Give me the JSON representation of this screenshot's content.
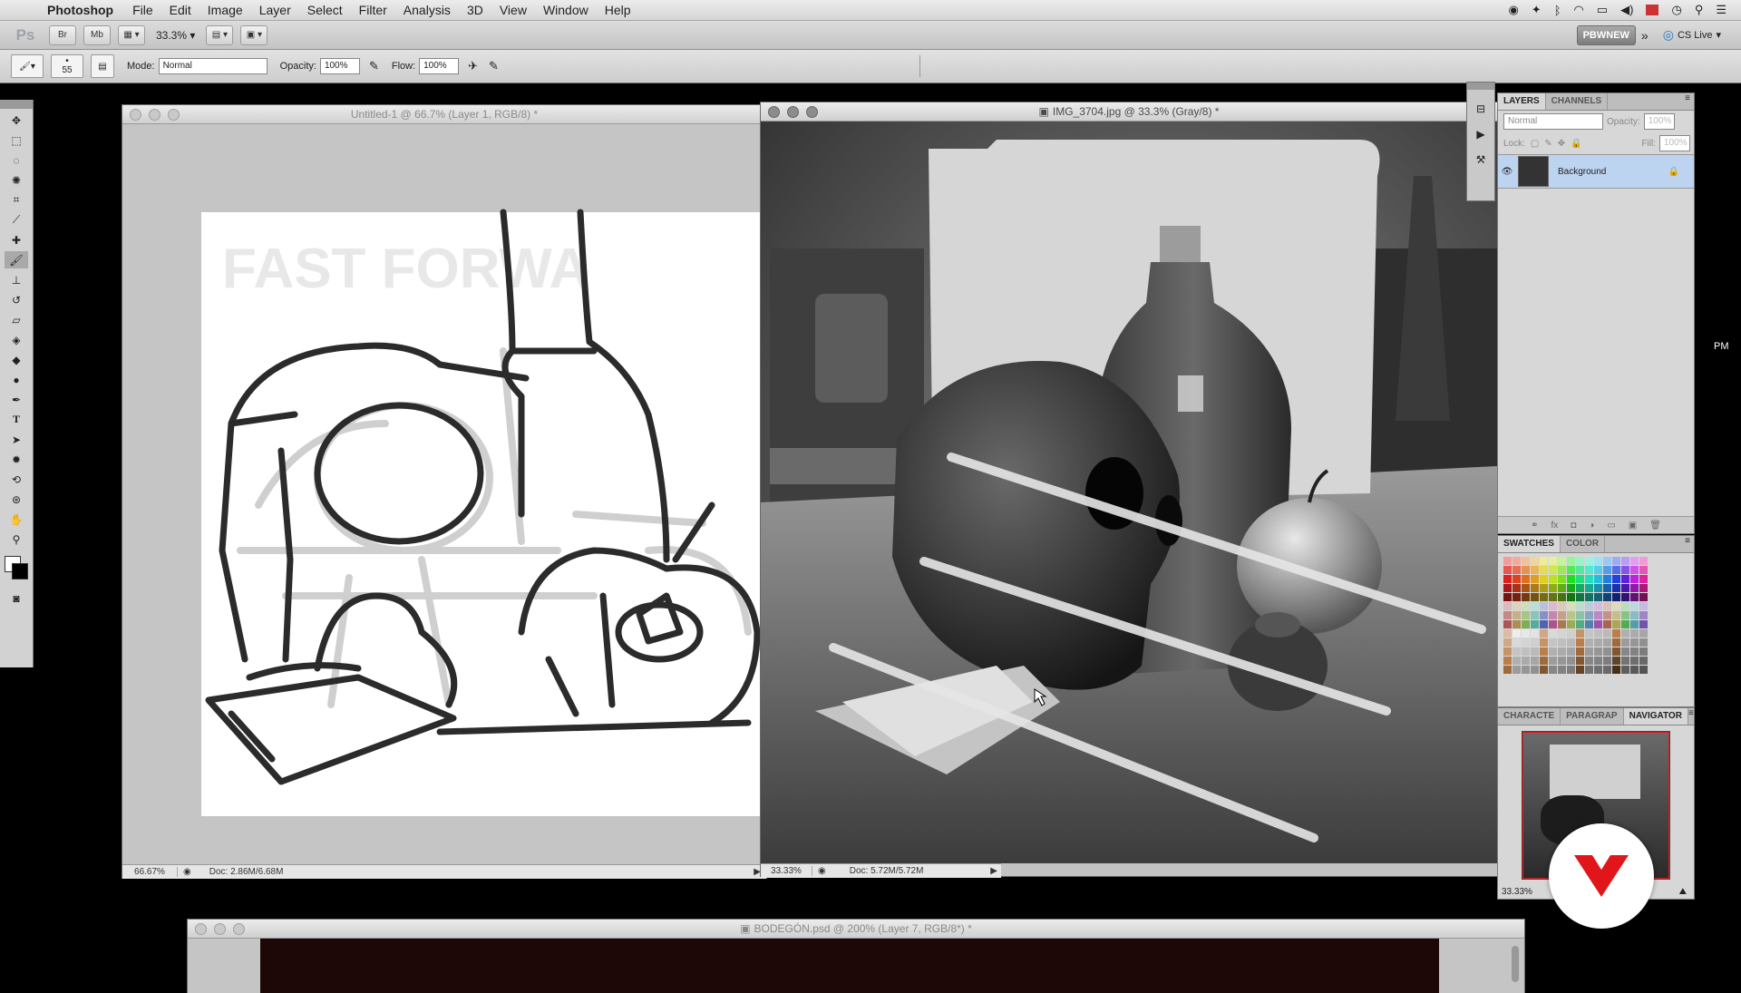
{
  "menubar": {
    "app_name": "Photoshop",
    "items": [
      "File",
      "Edit",
      "Image",
      "Layer",
      "Select",
      "Filter",
      "Analysis",
      "3D",
      "View",
      "Window",
      "Help"
    ]
  },
  "appbar": {
    "logo": "Ps",
    "bridge_label": "Br",
    "minibridge_label": "Mb",
    "zoom": "33.3%",
    "workspace": "PBWNEW",
    "cs_live": "CS Live"
  },
  "options": {
    "brush_size": "55",
    "mode_label": "Mode:",
    "mode_value": "Normal",
    "opacity_label": "Opacity:",
    "opacity_value": "100%",
    "flow_label": "Flow:",
    "flow_value": "100%"
  },
  "doc1": {
    "title": "Untitled-1 @ 66.7% (Layer 1, RGB/8) *",
    "zoom": "66.67%",
    "doc_size": "Doc: 2.86M/6.68M",
    "canvas_text": "FAST FORWA"
  },
  "doc2": {
    "title": "IMG_3704.jpg @ 33.3% (Gray/8) *",
    "zoom": "33.33%",
    "doc_size": "Doc: 5.72M/5.72M"
  },
  "doc3": {
    "title": "BODEGÓN.psd @ 200% (Layer 7, RGB/8*) *"
  },
  "layers_panel": {
    "tabs": [
      "LAYERS",
      "CHANNELS"
    ],
    "blend_mode": "Normal",
    "opacity_label": "Opacity:",
    "opacity_value": "100%",
    "lock_label": "Lock:",
    "fill_label": "Fill:",
    "fill_value": "100%",
    "layer_name": "Background"
  },
  "swatches_panel": {
    "tabs": [
      "SWATCHES",
      "COLOR"
    ]
  },
  "navigator_panel": {
    "tabs": [
      "CHARACTE",
      "PARAGRAP",
      "NAVIGATOR"
    ],
    "zoom": "33.33%"
  },
  "edge_text": "PM",
  "colors": {
    "layer_selected": "#bcd4f0",
    "accent_red": "#e0161b"
  }
}
